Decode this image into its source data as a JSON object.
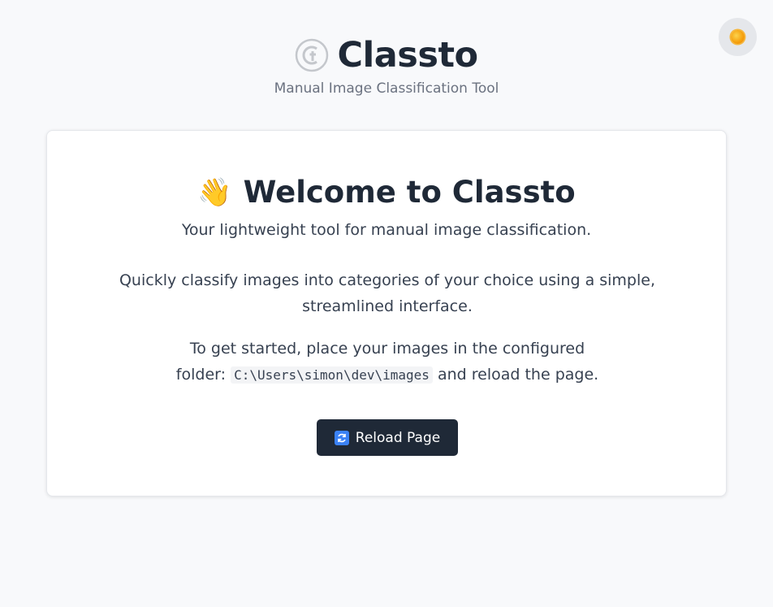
{
  "app": {
    "title": "Classto",
    "subtitle": "Manual Image Classification Tool",
    "logo_icon": "ct-logo-icon",
    "theme_toggle_icon": "sun-icon"
  },
  "welcome": {
    "icon": "waving-hand-icon",
    "emoji": "👋",
    "title": "Welcome to Classto",
    "tagline": "Your lightweight tool for manual image classification.",
    "description": "Quickly classify images into categories of your choice using a simple, streamlined interface.",
    "instructions_prefix": "To get started, place your images in the configured folder:",
    "folder_path": "C:\\Users\\simon\\dev\\images",
    "instructions_suffix": "and reload the page."
  },
  "actions": {
    "reload_label": "Reload Page",
    "reload_icon": "refresh-icon"
  },
  "colors": {
    "background": "#f8f9fb",
    "card": "#ffffff",
    "primary_button": "#1f2937",
    "text_muted": "#6b7280",
    "sun": "#f59e0b",
    "refresh_icon": "#3b82f6"
  }
}
